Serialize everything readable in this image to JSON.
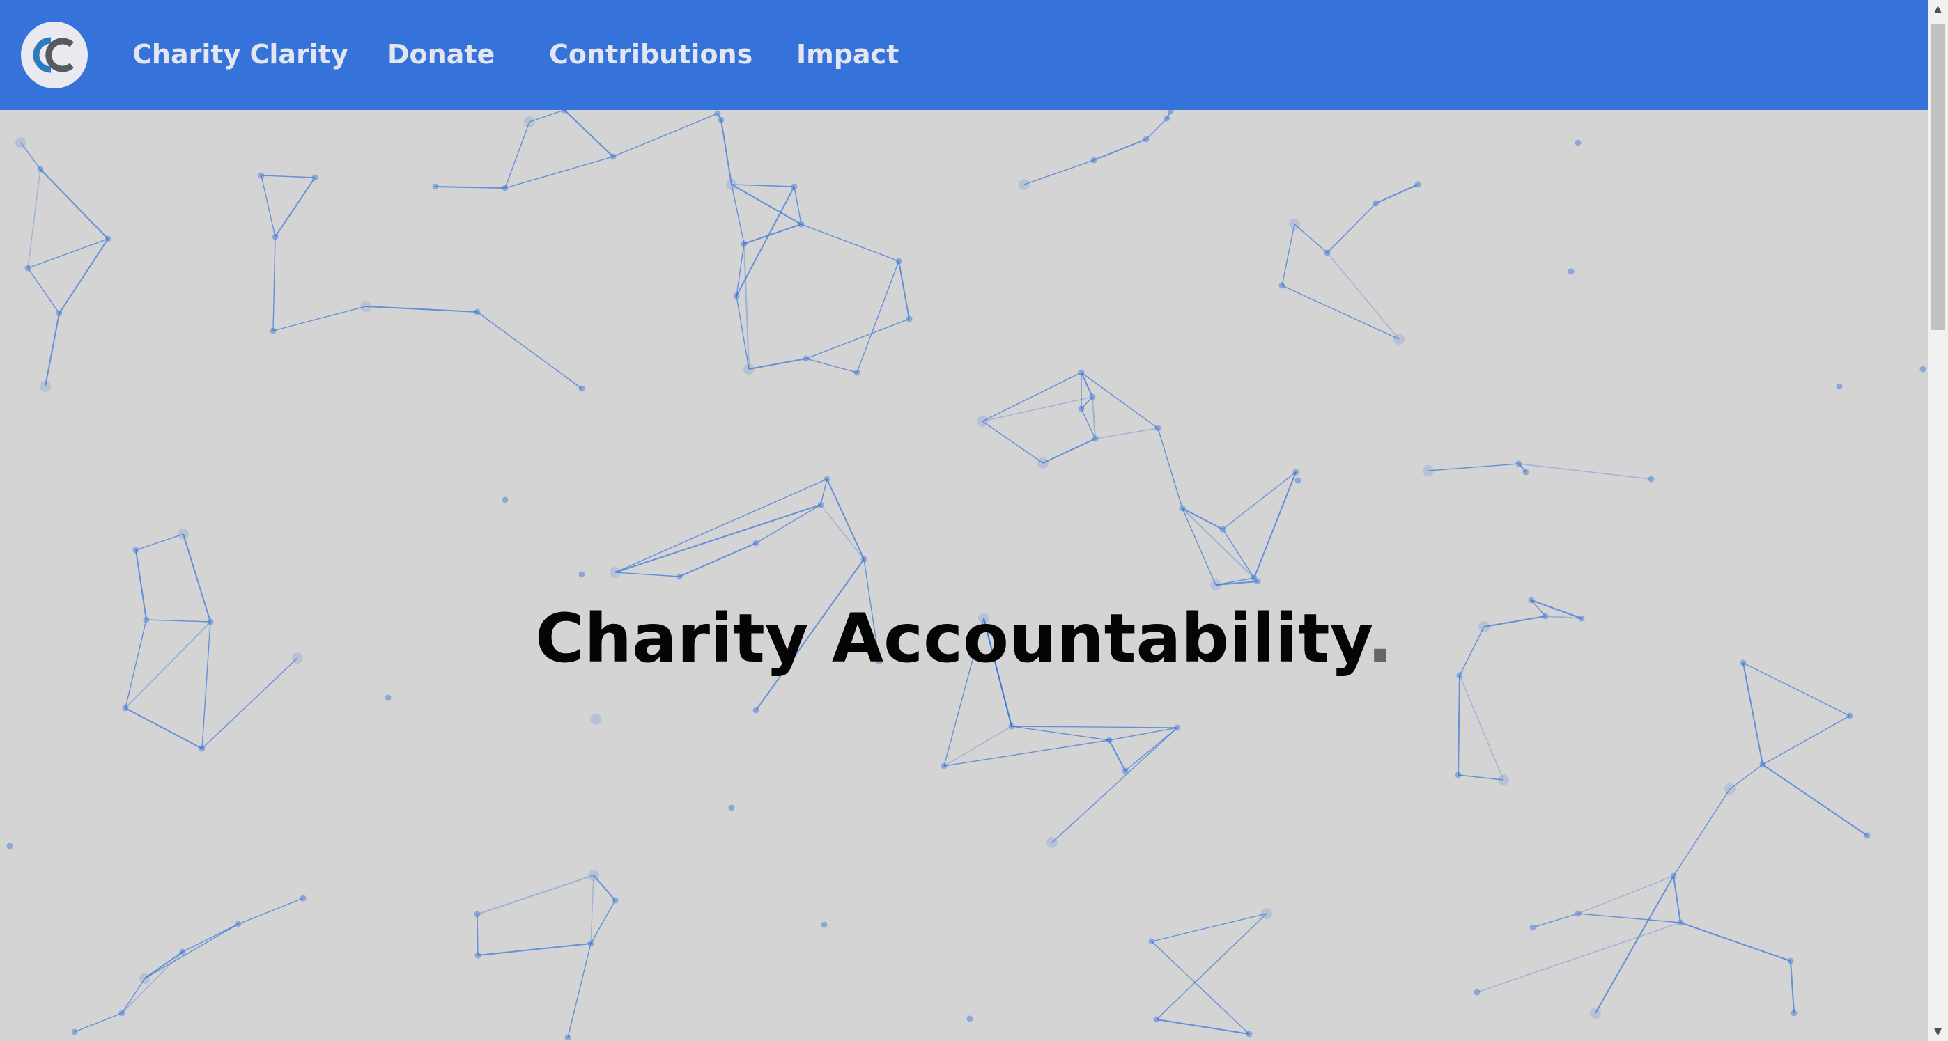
{
  "nav": {
    "logo_alt": "Charity Clarity logo",
    "items": [
      {
        "label": "Charity Clarity"
      },
      {
        "label": "Donate"
      },
      {
        "label": "Contributions"
      },
      {
        "label": "Impact"
      }
    ]
  },
  "hero": {
    "title": "Charity Accountability",
    "punct": "."
  },
  "colors": {
    "nav_bg": "#3573da",
    "page_bg": "#d4d4d4",
    "network_line": "#3573da",
    "title": "#050505"
  },
  "background": {
    "icon": "particle-network"
  }
}
